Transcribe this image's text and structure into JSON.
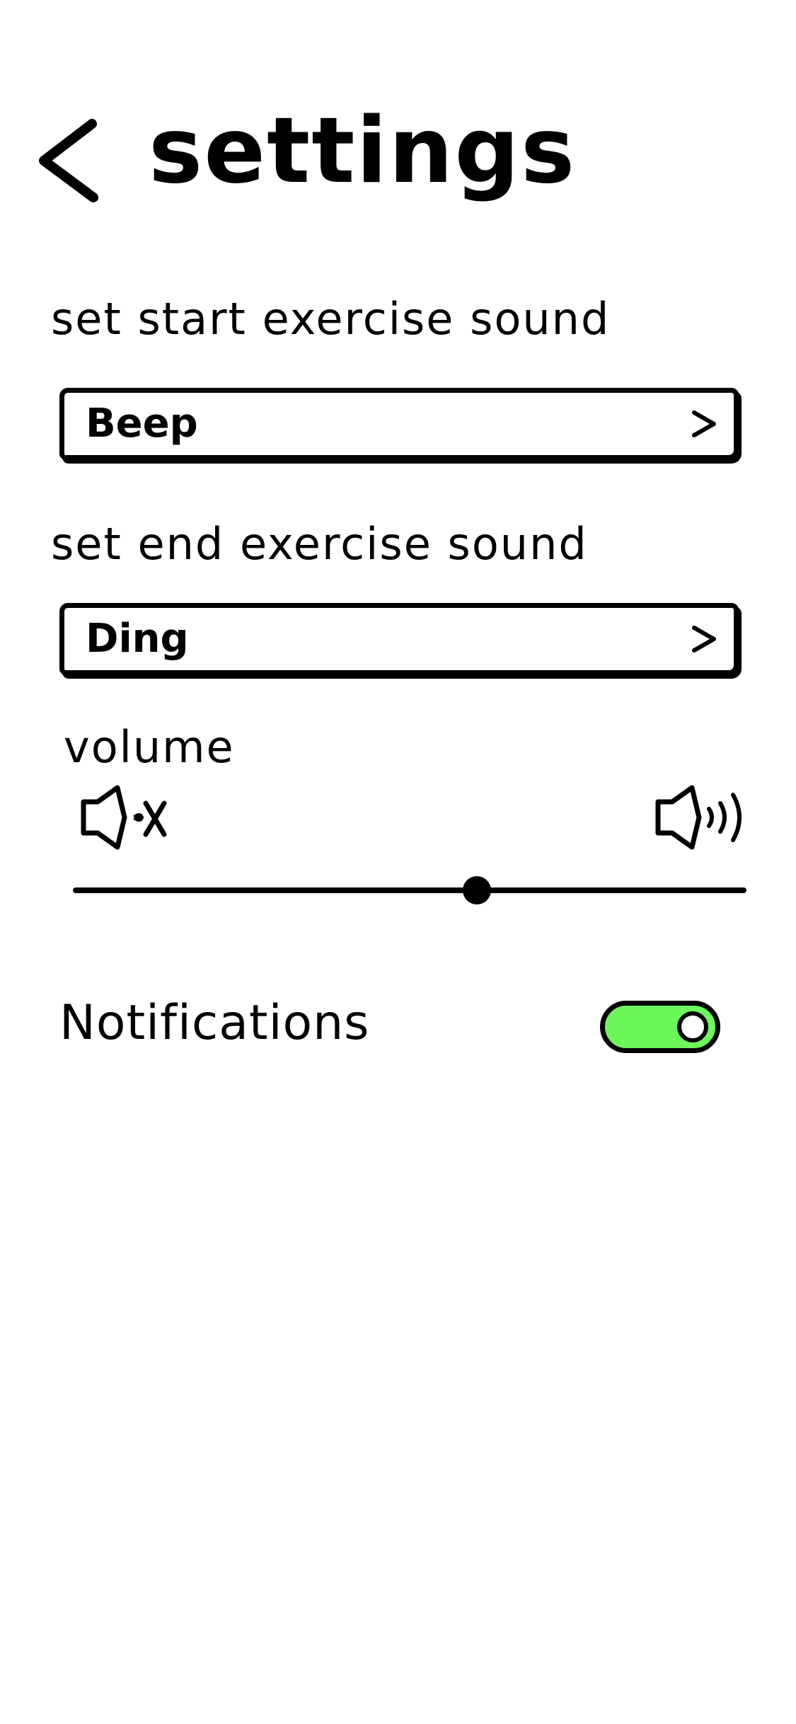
{
  "header": {
    "title": "settings",
    "back_icon": "chevron-left-icon"
  },
  "start_sound": {
    "label": "set start exercise sound",
    "value": "Beep",
    "chevron_icon": "chevron-right-icon"
  },
  "end_sound": {
    "label": "set end exercise sound",
    "value": "Ding",
    "chevron_icon": "chevron-right-icon"
  },
  "volume": {
    "label": "volume",
    "min_icon": "speaker-mute-icon",
    "max_icon": "speaker-loud-icon",
    "level": 0.6
  },
  "notifications": {
    "label": "Notifications",
    "enabled": true
  },
  "colors": {
    "toggle_on": "#6cf75b",
    "ink": "#000000",
    "background": "#ffffff"
  }
}
